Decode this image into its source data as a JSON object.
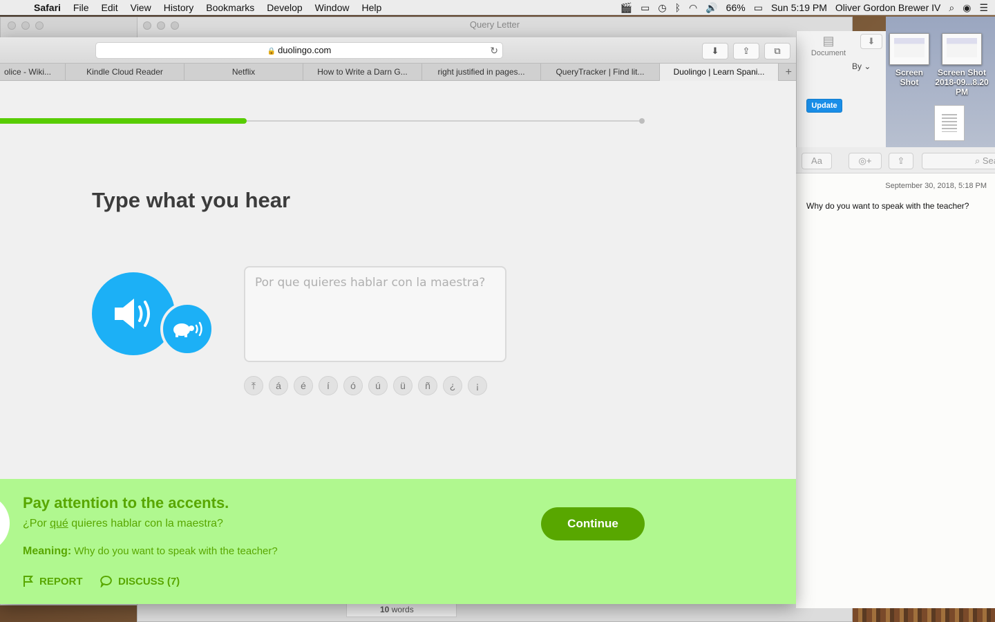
{
  "menubar": {
    "app_name": "Safari",
    "items": [
      "File",
      "Edit",
      "View",
      "History",
      "Bookmarks",
      "Develop",
      "Window",
      "Help"
    ],
    "battery": "66%",
    "clock": "Sun 5:19 PM",
    "user": "Oliver Gordon Brewer IV"
  },
  "pages_window": {
    "title": "Query Letter",
    "document_label": "Document",
    "sort_label": "By",
    "update_label": "Update",
    "word_count": "10",
    "word_count_unit": "words"
  },
  "desktop": {
    "icons": [
      {
        "label": "Screen Shot"
      },
      {
        "label": "Screen Shot 2018-09...8.20 PM"
      }
    ]
  },
  "notes": {
    "format_label": "Aa",
    "search_label": "Sea",
    "date": "September 30, 2018, 5:18 PM",
    "text": "Why do you want to speak with the teacher?"
  },
  "safari": {
    "url": "duolingo.com",
    "tabs": [
      {
        "label": "olice - Wiki..."
      },
      {
        "label": "Kindle Cloud Reader"
      },
      {
        "label": "Netflix"
      },
      {
        "label": "How to Write a Darn G..."
      },
      {
        "label": "right justified in pages..."
      },
      {
        "label": "QueryTracker | Find lit..."
      },
      {
        "label": "Duolingo | Learn Spani..."
      }
    ],
    "new_tab_label": "+"
  },
  "lesson": {
    "progress": 0.384,
    "title": "Type what you hear",
    "answer_placeholder": "Por que quieres hablar con la maestra?",
    "accent_keys": [
      "⤒",
      "á",
      "é",
      "í",
      "ó",
      "ú",
      "ü",
      "ñ",
      "¿",
      "¡"
    ]
  },
  "feedback": {
    "heading": "Pay attention to the accents.",
    "sentence_before": "¿Por ",
    "sentence_highlight": "qué",
    "sentence_after": " quieres hablar con la maestra?",
    "meaning_label": "Meaning:",
    "meaning_text": "Why do you want to speak with the teacher?",
    "report_label": "REPORT",
    "discuss_label": "DISCUSS (7)",
    "continue_label": "Continue"
  },
  "colors": {
    "duo_green": "#58cc02",
    "feedback_bg": "#b0f88f",
    "feedback_text": "#58a700",
    "duo_blue": "#1cb0f6"
  }
}
